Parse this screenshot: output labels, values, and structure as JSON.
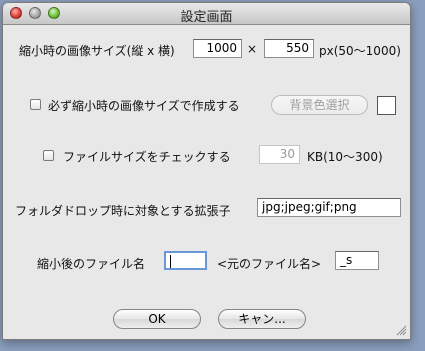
{
  "window": {
    "title": "設定画面"
  },
  "size_row": {
    "label": "縮小時の画像サイズ(縦 x 横)",
    "height_value": "1000",
    "separator": "×",
    "width_value": "550",
    "unit_hint": "px(50〜1000)"
  },
  "same_size_option": {
    "label": "必ず縮小時の画像サイズで作成する",
    "checked": false,
    "bg_button_label": "背景色選択",
    "bg_color": "#ffffff"
  },
  "filesize_option": {
    "label": "ファイルサイズをチェックする",
    "checked": false,
    "value": "30",
    "unit_hint": "KB(10〜300)"
  },
  "extensions": {
    "label": "フォルダドロップ時に対象とする拡張子",
    "value": "jpg;jpeg;gif;png"
  },
  "filename": {
    "label": "縮小後のファイル名",
    "prefix_value": "",
    "middle_text": "<元のファイル名>",
    "suffix_value": "_s"
  },
  "buttons": {
    "ok_label": "OK",
    "cancel_label": "キャン..."
  },
  "icons": {
    "close": "close-icon",
    "minimize": "minimize-icon",
    "zoom": "zoom-icon",
    "grip": "resize-grip-icon"
  }
}
